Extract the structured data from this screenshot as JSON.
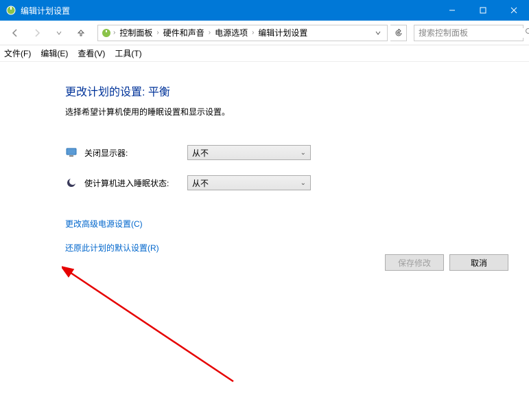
{
  "window": {
    "title": "编辑计划设置"
  },
  "breadcrumb": {
    "items": [
      "控制面板",
      "硬件和声音",
      "电源选项",
      "编辑计划设置"
    ]
  },
  "search": {
    "placeholder": "搜索控制面板"
  },
  "menu": {
    "file": "文件(F)",
    "edit": "编辑(E)",
    "view": "查看(V)",
    "tools": "工具(T)"
  },
  "page": {
    "heading": "更改计划的设置: 平衡",
    "subtext": "选择希望计算机使用的睡眠设置和显示设置。",
    "turn_off_display_label": "关闭显示器:",
    "sleep_label": "使计算机进入睡眠状态:",
    "turn_off_display_value": "从不",
    "sleep_value": "从不",
    "link_advanced": "更改高级电源设置(C)",
    "link_restore": "还原此计划的默认设置(R)",
    "save_button": "保存修改",
    "cancel_button": "取消"
  }
}
